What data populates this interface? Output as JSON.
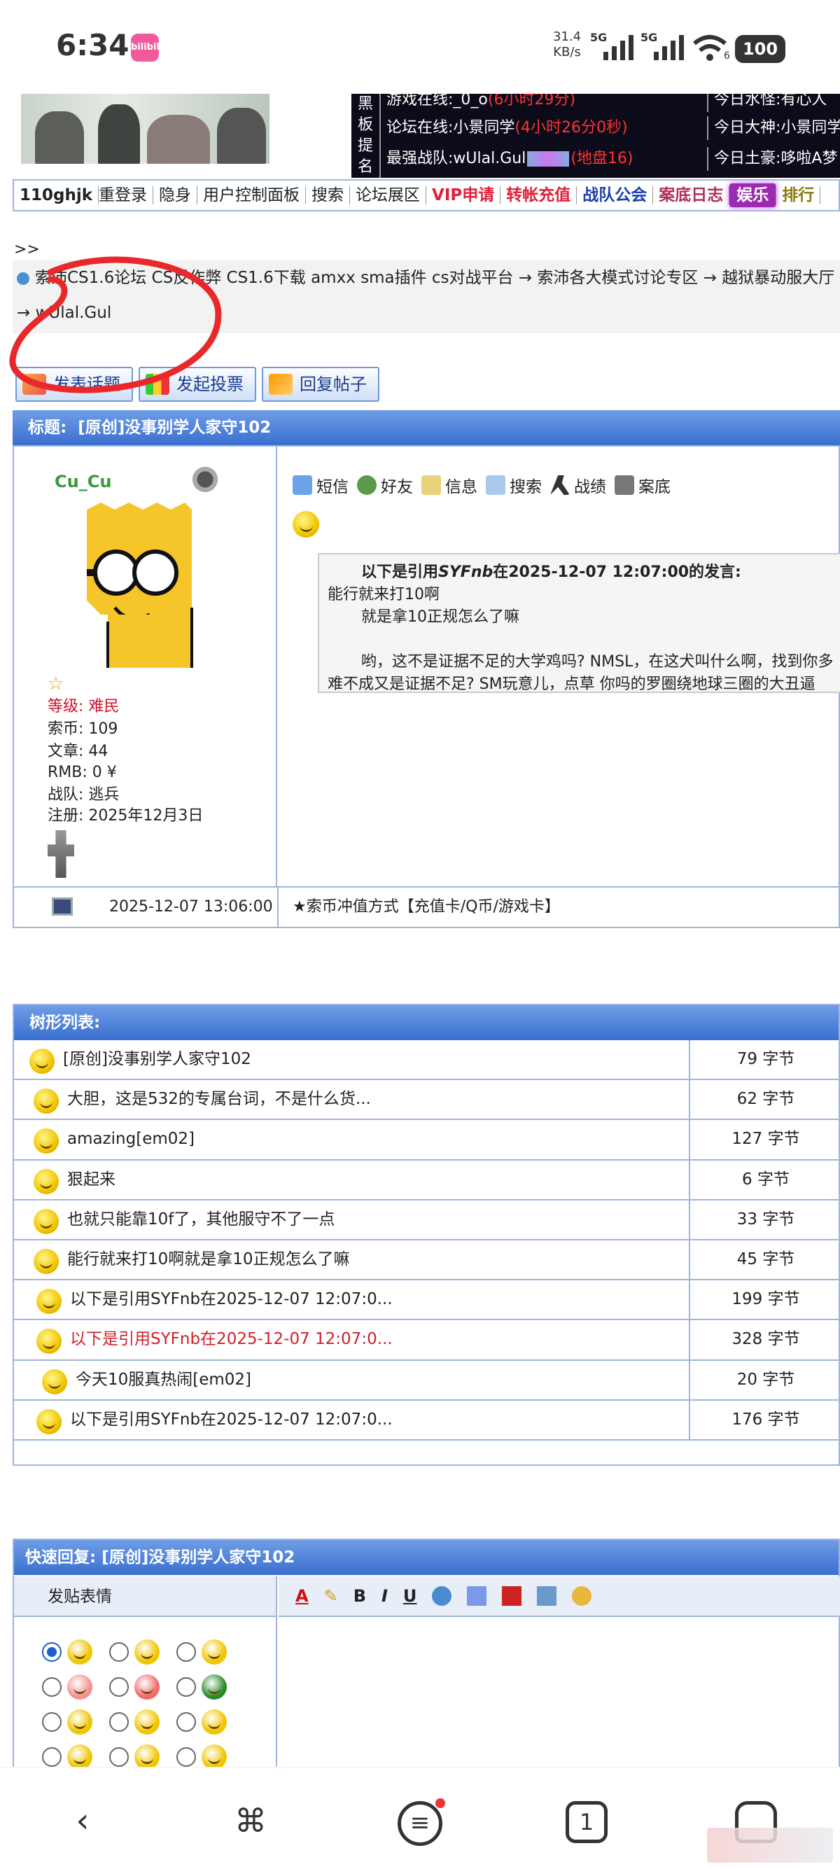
{
  "status": {
    "time": "6:34",
    "app_badge": "bilibili",
    "net_speed_top": "31.4",
    "net_speed_unit": "KB/s",
    "sig1": "5G",
    "sig2": "5G",
    "wifi_level": "6",
    "battery": "100"
  },
  "header": {
    "board_label": "黑板提名",
    "row1_left": "游戏在线:_0_o",
    "row1_left_red": "(6小时29分)",
    "row1_right": "今日水怪:有心人",
    "row2_left": "论坛在线:小景同学",
    "row2_left_red": "(4小时26分0秒)",
    "row2_right": "今日大神:小景同学",
    "row3_left": "最强战队:wUlal.Gul",
    "row3_left_red": "(地盘16)",
    "row3_right": "今日土豪:哆啦A梦"
  },
  "menu": {
    "user": "110ghjk",
    "relogin": "重登录",
    "hide": "隐身",
    "control": "用户控制面板",
    "search": "搜索",
    "forum": "论坛展区",
    "vip": "VIP申请",
    "recharge": "转帐充值",
    "guild": "战队公会",
    "log": "案底日志",
    "ent": "娱乐",
    "rank": "排行"
  },
  "breadcrumb": {
    "prefix": ">>",
    "line1": "索沛CS1.6论坛 CS反作弊 CS1.6下载 amxx sma插件 cs对战平台 → 索沛各大模式讨论专区 → 越狱暴动服大厅",
    "line2": "→ wUlal.Gul"
  },
  "actions": {
    "new_topic": "发表话题",
    "new_poll": "发起投票",
    "reply": "回复帖子"
  },
  "post": {
    "title_label": "标题:",
    "title": "[原创]没事别学人家守102",
    "author": "Cu_Cu",
    "level_label": "等级:",
    "level": "难民",
    "coins": "索币: 109",
    "articles": "文章: 44",
    "rmb": "RMB: 0 ¥",
    "team": "战队: 逃兵",
    "reg": "注册: 2025年12月3日",
    "tools": [
      "短信",
      "好友",
      "信息",
      "搜索",
      "战绩",
      "案底"
    ],
    "quote_header": "以下是引用",
    "quote_user": "SYFnb",
    "quote_at": "在2025-12-07 12:07:00的发言:",
    "quote_lines": [
      "能行就来打10啊",
      "就是拿10正规怎么了嘛",
      "",
      "哟，这不是证据不足的大学鸡吗? NMSL，在这犬叫什么啊，找到你多",
      "难不成又是证据不足? SM玩意儿，点草 你吗的罗圈绕地球三圈的大丑逼"
    ],
    "time": "2025-12-07 13:06:00",
    "ad": "★索币冲值方式【充值卡/Q币/游戏卡】"
  },
  "tree": {
    "header": "树形列表:",
    "rows": [
      {
        "title": "[原创]没事别学人家守102",
        "size": "79 字节"
      },
      {
        "title": "大胆，这是532的专属台词，不是什么货...",
        "size": "62 字节"
      },
      {
        "title": "amazing[em02]",
        "size": "127 字节"
      },
      {
        "title": "狠起来",
        "size": "6 字节"
      },
      {
        "title": "也就只能靠10f了，其他服守不了一点",
        "size": "33 字节"
      },
      {
        "title": "能行就来打10啊就是拿10正规怎么了嘛",
        "size": "45 字节"
      },
      {
        "title": "以下是引用SYFnb在2025-12-07 12:07:0...",
        "size": "199 字节"
      },
      {
        "title": "以下是引用SYFnb在2025-12-07 12:07:0...",
        "size": "328 字节",
        "current": true
      },
      {
        "title": "今天10服真热闹[em02]",
        "size": "20 字节"
      },
      {
        "title": "以下是引用SYFnb在2025-12-07 12:07:0...",
        "size": "176 字节"
      }
    ]
  },
  "quick_reply": {
    "header": "快速回复: [原创]没事别学人家守102",
    "emo_title": "发贴表情",
    "toolbar": [
      "A",
      "✎",
      "B",
      "I",
      "U"
    ]
  },
  "colors": {
    "accent": "#3a6fd0",
    "red": "#d0202a",
    "border": "#9fb6d9"
  }
}
